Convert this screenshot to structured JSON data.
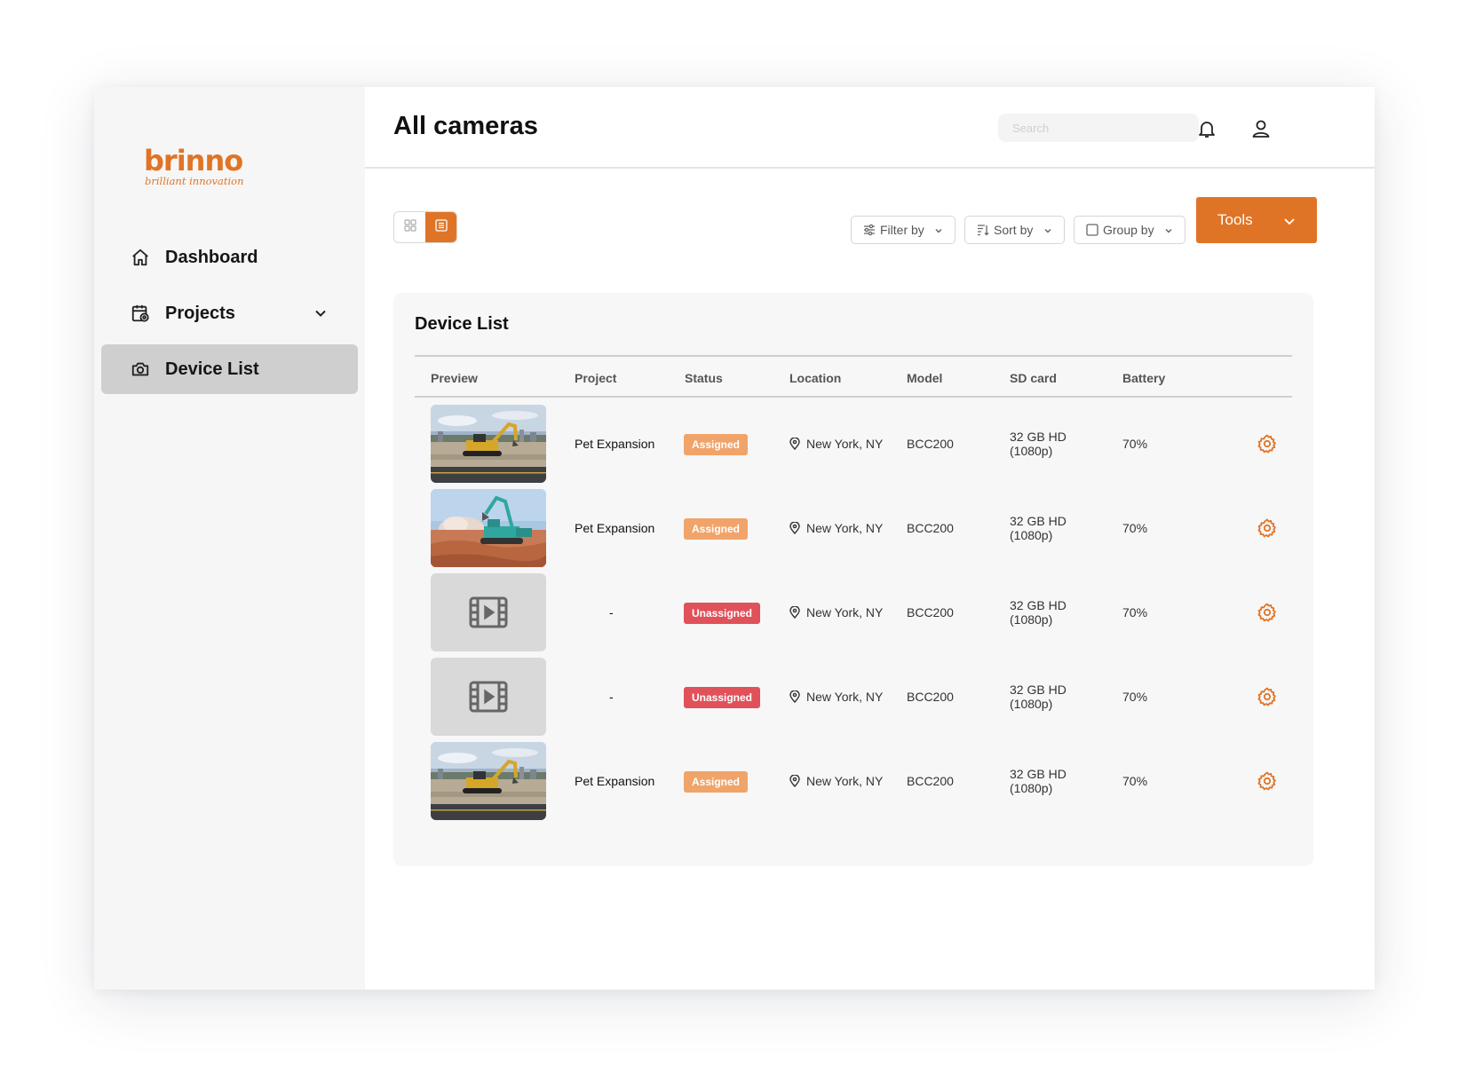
{
  "app": {
    "brand": "brinno",
    "tagline": "brilliant innovation",
    "accent": "#e07426"
  },
  "sidebar": {
    "items": [
      {
        "label": "Dashboard",
        "icon": "home-icon"
      },
      {
        "label": "Projects",
        "icon": "calendar-settings-icon"
      },
      {
        "label": "Device List",
        "icon": "camera-icon",
        "active": true
      }
    ]
  },
  "header": {
    "title": "All cameras",
    "search_placeholder": "Search"
  },
  "toolbar": {
    "filter_label": "Filter by",
    "sort_label": "Sort by",
    "group_label": "Group by",
    "tools_label": "Tools",
    "view_mode": "list"
  },
  "device_list": {
    "title": "Device List",
    "columns": [
      "Preview",
      "Project",
      "Status",
      "Location",
      "Model",
      "SD card",
      "Battery"
    ],
    "rows": [
      {
        "preview": "construction-photo-yellow-excavator",
        "project": "Pet Expansion",
        "status": "Assigned",
        "location": "New York, NY",
        "model": "BCC200",
        "sd_line1": "32 GB HD",
        "sd_line2": "(1080p)",
        "battery": "70%"
      },
      {
        "preview": "construction-photo-teal-excavator",
        "project": "Pet Expansion",
        "status": "Assigned",
        "location": "New York, NY",
        "model": "BCC200",
        "sd_line1": "32 GB HD",
        "sd_line2": "(1080p)",
        "battery": "70%"
      },
      {
        "preview": "video-placeholder-icon",
        "project": "-",
        "status": "Unassigned",
        "location": "New York, NY",
        "model": "BCC200",
        "sd_line1": "32 GB HD",
        "sd_line2": "(1080p)",
        "battery": "70%"
      },
      {
        "preview": "video-placeholder-icon",
        "project": "-",
        "status": "Unassigned",
        "location": "New York, NY",
        "model": "BCC200",
        "sd_line1": "32 GB HD",
        "sd_line2": "(1080p)",
        "battery": "70%"
      },
      {
        "preview": "construction-photo-yellow-excavator",
        "project": "Pet Expansion",
        "status": "Assigned",
        "location": "New York, NY",
        "model": "BCC200",
        "sd_line1": "32 GB HD",
        "sd_line2": "(1080p)",
        "battery": "70%"
      }
    ]
  },
  "colors": {
    "assigned": "#f0a46a",
    "unassigned": "#e0515a",
    "active_nav": "#cfcfcf"
  }
}
